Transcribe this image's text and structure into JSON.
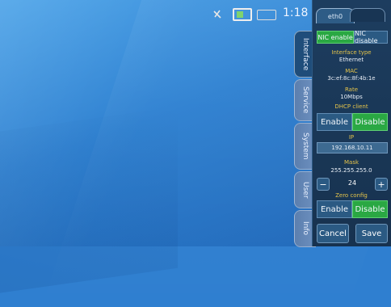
{
  "status_bar": {
    "time": "1:18"
  },
  "side_tabs": [
    "Interface",
    "Service",
    "System",
    "User",
    "Info"
  ],
  "panel": {
    "tab_active": "eth0",
    "nic": {
      "enable": "NIC enable",
      "disable": "NIC disable",
      "selected": "enable"
    },
    "interface_type": {
      "label": "Interface type",
      "value": "Ethernet"
    },
    "mac": {
      "label": "MAC",
      "value": "3c:ef:8c:8f:4b:1e"
    },
    "rate": {
      "label": "Rate",
      "value": "10Mbps"
    },
    "dhcp": {
      "label": "DHCP client",
      "enable": "Enable",
      "disable": "Disable",
      "selected": "disable"
    },
    "ip": {
      "label": "IP",
      "value": "192.168.10.11"
    },
    "mask": {
      "label": "Mask",
      "value": "255.255.255.0",
      "prefix": "24",
      "minus": "−",
      "plus": "+"
    },
    "zero_config": {
      "label": "Zero config",
      "enable": "Enable",
      "disable": "Disable",
      "selected": "disable"
    },
    "cancel": "Cancel",
    "save": "Save"
  },
  "colors": {
    "desktop_blue": "#2f7fd0",
    "panel_bg": "#1d3d5f",
    "active_green": "#2aa843",
    "label_yellow": "#e4c34a"
  },
  "icons": [
    "wifi-icon",
    "battery-icon",
    "monitor-icon"
  ]
}
